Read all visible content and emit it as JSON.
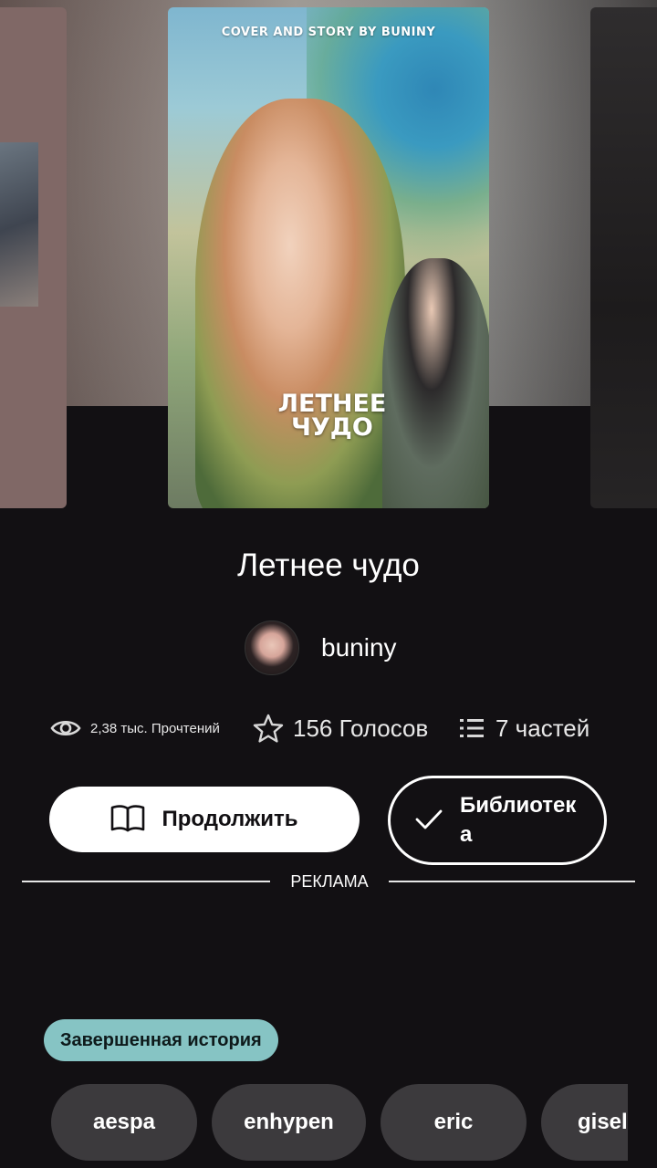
{
  "cover": {
    "top_text": "COVER AND STORY BY BUNINY",
    "title_art": "ЛЕТНЕЕ ЧУДО"
  },
  "story": {
    "title": "Летнее чудо",
    "author": "buniny",
    "reads": "2,38 тыс. Прочтений",
    "votes": "156 Голосов",
    "parts": "7 частей"
  },
  "actions": {
    "continue_label": "Продолжить",
    "library_label": "Библиотека"
  },
  "ad": {
    "label": "РЕКЛАМА"
  },
  "badge": {
    "label": "Завершенная история"
  },
  "tags": [
    "aespa",
    "enhypen",
    "eric",
    "giselle"
  ],
  "icons": {
    "reads": "eye-icon",
    "votes": "star-icon",
    "parts": "list-icon",
    "continue": "book-icon",
    "library": "check-icon"
  },
  "colors": {
    "background": "#121013",
    "badge": "#86c4c4",
    "tag": "#3c3a3d",
    "button": "#ffffff"
  }
}
